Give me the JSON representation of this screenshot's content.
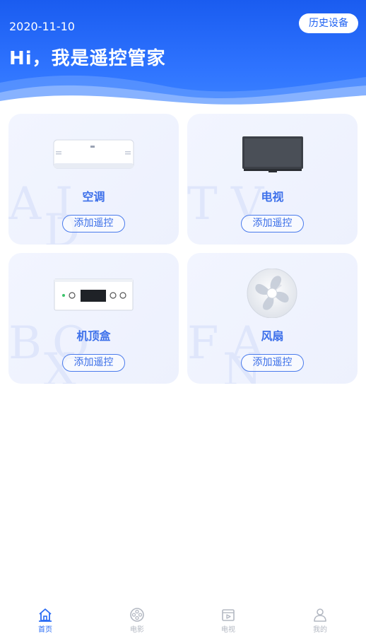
{
  "header": {
    "date": "2020-11-10",
    "greeting": "Hi，我是遥控管家",
    "history_button": "历史设备"
  },
  "devices": [
    {
      "name": "空调",
      "watermark": [
        "A",
        "I",
        "D"
      ],
      "button": "添加遥控",
      "icon": "air-conditioner-icon"
    },
    {
      "name": "电视",
      "watermark": [
        "T",
        "V"
      ],
      "button": "添加遥控",
      "icon": "television-icon"
    },
    {
      "name": "机顶盒",
      "watermark": [
        "B",
        "O",
        "X"
      ],
      "button": "添加遥控",
      "icon": "set-top-box-icon"
    },
    {
      "name": "风扇",
      "watermark": [
        "F",
        "A",
        "N"
      ],
      "button": "添加遥控",
      "icon": "fan-icon"
    }
  ],
  "tabbar": [
    {
      "label": "首页",
      "icon": "home-icon",
      "active": true
    },
    {
      "label": "电影",
      "icon": "film-reel-icon",
      "active": false
    },
    {
      "label": "电视",
      "icon": "tv-play-icon",
      "active": false
    },
    {
      "label": "我的",
      "icon": "user-icon",
      "active": false
    }
  ],
  "colors": {
    "primary": "#2a6cf4",
    "card_bg": "#eff3fe",
    "inactive_tab": "#b3b8c2"
  }
}
